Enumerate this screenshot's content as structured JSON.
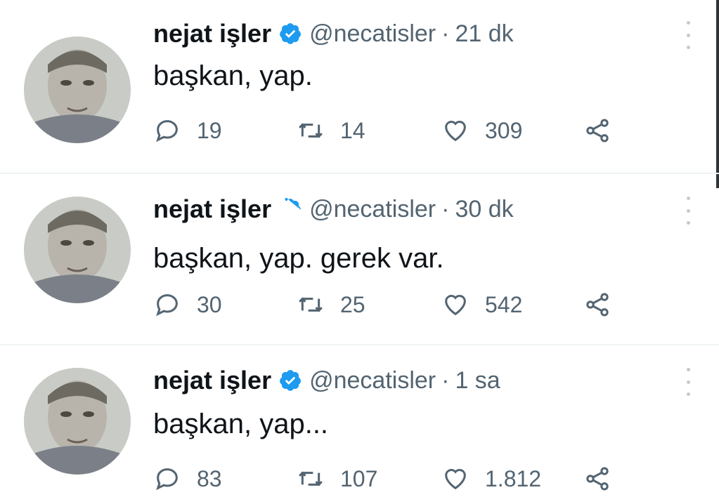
{
  "tweets": [
    {
      "name": "nejat işler",
      "handle": "@necatisler",
      "separator": "·",
      "time": "21 dk",
      "text": "başkan, yap.",
      "replies": "19",
      "retweets": "14",
      "likes": "309"
    },
    {
      "name": "nejat işler",
      "handle": "@necatisler",
      "separator": "·",
      "time": "30 dk",
      "text": "başkan, yap. gerek var.",
      "replies": "30",
      "retweets": "25",
      "likes": "542"
    },
    {
      "name": "nejat işler",
      "handle": "@necatisler",
      "separator": "·",
      "time": "1 sa",
      "text": "başkan, yap...",
      "replies": "83",
      "retweets": "107",
      "likes": "1.812"
    }
  ],
  "icons": {
    "reply": "reply-icon",
    "retweet": "retweet-icon",
    "like": "heart-icon",
    "share": "share-icon",
    "verified": "verified-badge-icon",
    "more": "more-options-icon"
  },
  "colors": {
    "verified": "#1d9bf0",
    "secondary_text": "#536471",
    "primary_text": "#0f1419"
  }
}
